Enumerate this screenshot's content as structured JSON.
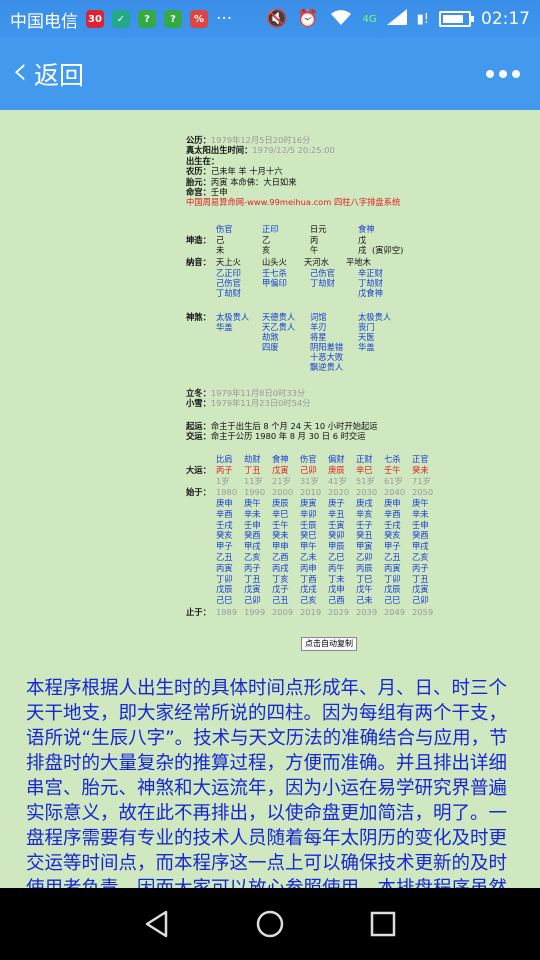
{
  "status_bar": {
    "carrier": "中国电信",
    "network": "4G",
    "time": "02:17",
    "battery_level": 0.85
  },
  "navbar": {
    "back_label": "返回"
  },
  "chart_info": {
    "gongli_label": "公历：",
    "gongli_value": "1979年12月5日20时16分",
    "zhentaiyang_label": "真太阳出生时间：",
    "zhentaiyang_value": "1979/12/5 20:25:00",
    "chusheng_label": "出生在：",
    "nongli_label": "农历：",
    "nongli_value": "己未年 羊 十月十六",
    "taiyuan_label": "胎元：",
    "taiyuan_value": "丙寅 本命佛：大日如来",
    "minggong_label": "命宫：",
    "minggong_value": "壬申",
    "site_line": "中国周易算命网-www.99meihua.com 四柱八字排盘系统"
  },
  "pillars": {
    "shishen": [
      "伤官",
      "正印",
      "日元",
      "食神"
    ],
    "qiankun_label": "坤造：",
    "tiangan": [
      "己",
      "乙",
      "丙",
      "戊"
    ],
    "dizhi": [
      "未",
      "亥",
      "午",
      "戌"
    ],
    "kongwang": "(寅卯空)",
    "nayin_label": "纳音：",
    "nayin": [
      "天上火",
      "山头火",
      "天河水",
      "平地木"
    ],
    "canggan_col1": [
      "乙正印",
      "己伤官",
      "丁劫财"
    ],
    "canggan_col2": [
      "壬七杀",
      "甲偏印"
    ],
    "canggan_col3": [
      "己伤官",
      "丁劫财"
    ],
    "canggan_col4": [
      "辛正财",
      "丁劫财",
      "戊食神"
    ],
    "shensha_label": "神煞：",
    "shensha_col1": [
      "太极贵人",
      "华盖"
    ],
    "shensha_col2": [
      "天德贵人",
      "天乙贵人",
      "劫煞",
      "四废"
    ],
    "shensha_col3": [
      "词馆",
      "羊刃",
      "将星",
      "阴阳差错",
      "十恶大败",
      "飘逆贵人"
    ],
    "shensha_col4": [
      "太极贵人",
      "丧门",
      "天医",
      "华盖"
    ]
  },
  "jieqi": {
    "lidong_label": "立冬：",
    "lidong_value": "1979年11月8日0时33分",
    "xiaoxue_label": "小雪：",
    "xiaoxue_value": "1979年11月23日0时54分",
    "qiyun_label": "起运：",
    "qiyun_value": "命主于出生后 8 个月 24 天 10 小时开始起运",
    "jiaoyun_label": "交运：",
    "jiaoyun_value": "命主于公历 1980 年 8 月 30 日 6 时交运"
  },
  "dayun": {
    "label": "大运：",
    "shishen": [
      "比肩",
      "劫财",
      "食神",
      "伤官",
      "偏财",
      "正财",
      "七杀",
      "正官"
    ],
    "ganzhi": [
      "丙子",
      "丁丑",
      "戊寅",
      "己卯",
      "庚辰",
      "辛巳",
      "壬午",
      "癸未"
    ],
    "ages": [
      "1岁",
      "11岁",
      "21岁",
      "31岁",
      "41岁",
      "51岁",
      "61岁",
      "71岁"
    ],
    "start_label": "始于：",
    "start_years": [
      "1980",
      "1990",
      "2000",
      "2010",
      "2020",
      "2030",
      "2040",
      "2050"
    ],
    "end_label": "止于：",
    "end_years": [
      "1989",
      "1999",
      "2009",
      "2019",
      "2029",
      "2039",
      "2049",
      "2059"
    ],
    "liunian": [
      [
        "庚申",
        "辛酉",
        "壬戌",
        "癸亥",
        "甲子",
        "乙丑",
        "丙寅",
        "丁卯",
        "戊辰",
        "己巳"
      ],
      [
        "庚午",
        "辛未",
        "壬申",
        "癸酉",
        "甲戌",
        "乙亥",
        "丙子",
        "丁丑",
        "戊寅",
        "己卯"
      ],
      [
        "庚辰",
        "辛巳",
        "壬午",
        "癸未",
        "甲申",
        "乙酉",
        "丙戌",
        "丁亥",
        "戊子",
        "己丑"
      ],
      [
        "庚寅",
        "辛卯",
        "壬辰",
        "癸巳",
        "甲午",
        "乙未",
        "丙申",
        "丁酉",
        "戊戌",
        "己亥"
      ],
      [
        "庚子",
        "辛丑",
        "壬寅",
        "癸卯",
        "甲辰",
        "乙巳",
        "丙午",
        "丁未",
        "戊申",
        "己酉"
      ],
      [
        "庚戌",
        "辛亥",
        "壬子",
        "癸丑",
        "甲寅",
        "乙卯",
        "丙辰",
        "丁巳",
        "戊午",
        "己未"
      ],
      [
        "庚申",
        "辛酉",
        "壬戌",
        "癸亥",
        "甲子",
        "乙丑",
        "丙寅",
        "丁卯",
        "戊辰",
        "己巳"
      ],
      [
        "庚午",
        "辛未",
        "壬申",
        "癸酉",
        "甲戌",
        "乙亥",
        "丙子",
        "丁丑",
        "戊寅",
        "己卯"
      ]
    ]
  },
  "copy_button_label": "点击自动复制",
  "paragraph_lines": [
    "本程序根据人出生时的具体时间点形成年、月、日、时三个",
    "天干地支，即大家经常所说的四柱。因为每组有两个干支，",
    "语所说“生辰八字”。技术与天文历法的准确结合与应用，节",
    "排盘时的大量复杂的推算过程，方便而准确。并且排出详细",
    "串宫、胎元、神煞和大运流年，因为小运在易学研究界普遍",
    "实际意义，故在此不再排出，以使命盘更加简洁，明了。一",
    "盘程序需要有专业的技术人员随着每年太阴历的变化及时更",
    "交运等时间点，而本程序这一点上可以确保技术更新的及时",
    "使用者负责，因而大家可以放心参照使用。本排盘程序虽然"
  ]
}
